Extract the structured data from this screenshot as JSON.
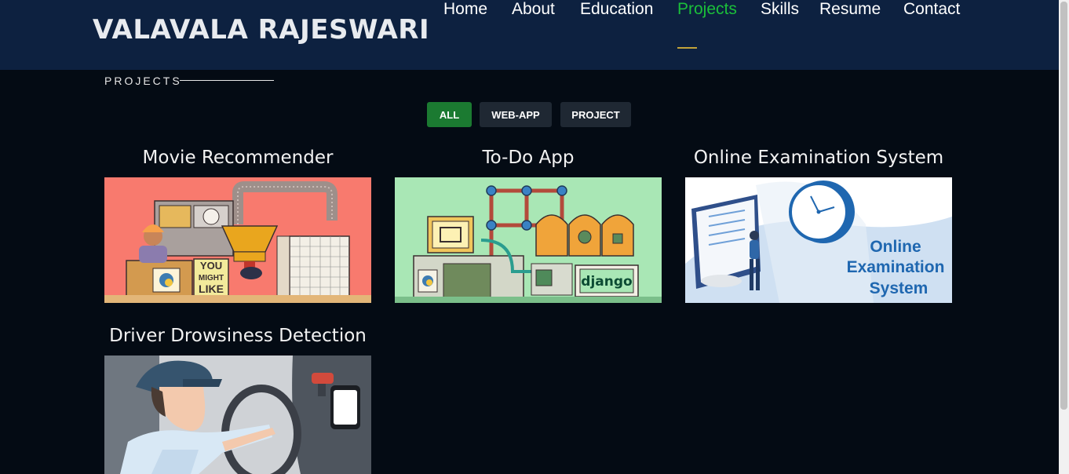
{
  "header": {
    "logo": "VALAVALA RAJESWARI",
    "nav": [
      {
        "label": "Home",
        "active": false
      },
      {
        "label": "About",
        "active": false
      },
      {
        "label": "Education",
        "active": false
      },
      {
        "label": "Projects",
        "active": true
      },
      {
        "label": "Skills",
        "active": false
      },
      {
        "label": "Resume",
        "active": false
      },
      {
        "label": "Contact",
        "active": false
      }
    ]
  },
  "section": {
    "title": "PROJECTS"
  },
  "filters": [
    {
      "label": "ALL",
      "active": true
    },
    {
      "label": "WEB-APP",
      "active": false
    },
    {
      "label": "PROJECT",
      "active": false
    }
  ],
  "projects": [
    {
      "title": "Movie Recommender",
      "image_text": [
        "YOU",
        "MIGHT",
        "LIKE"
      ]
    },
    {
      "title": "To-Do App",
      "image_text": [
        "django"
      ]
    },
    {
      "title": "Online Examination System",
      "image_text": [
        "Online",
        "Examination",
        "System"
      ]
    },
    {
      "title": "Driver Drowsiness Detection",
      "image_text": []
    }
  ],
  "colors": {
    "header_bg": "#0d2140",
    "page_bg": "#040b14",
    "accent_green": "#1bbf3a",
    "filter_active": "#1b7a31",
    "filter_inactive": "#1f2833"
  }
}
